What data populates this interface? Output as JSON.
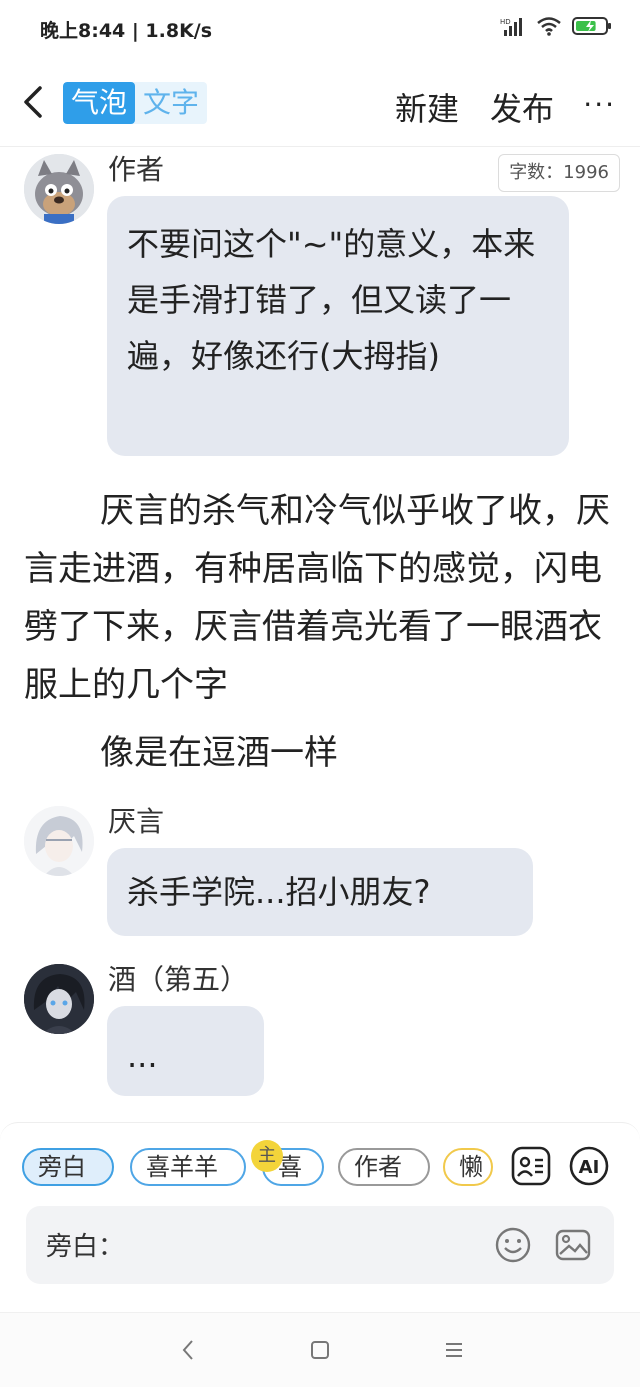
{
  "status_bar": {
    "time": "晚上8:44 | 1.8K/s",
    "battery_level": 0.7
  },
  "header": {
    "mode_active": "气泡",
    "mode_inactive": "文字",
    "new_label": "新建",
    "publish_label": "发布",
    "more_label": "···"
  },
  "word_count": "字数：1996",
  "messages": [
    {
      "speaker": "作者",
      "text": "不要问这个\"~\"的意义，本来是手滑打错了，但又读了一遍，好像还行(大拇指)"
    },
    {
      "speaker": "厌言",
      "text": "杀手学院...招小朋友?"
    },
    {
      "speaker": "酒（第五）",
      "text": "..."
    }
  ],
  "narration": [
    "厌言的杀气和冷气似乎收了收，厌言走进酒，有种居高临下的感觉，闪电劈了下来，厌言借着亮光看了一眼酒衣服上的几个字",
    "像是在逗酒一样"
  ],
  "chips": [
    {
      "label": "旁白"
    },
    {
      "label": "喜羊羊"
    },
    {
      "label": "喜"
    },
    {
      "label": "作者"
    },
    {
      "label": "懒"
    }
  ],
  "host_badge": "主",
  "ai_label": "AI",
  "input": {
    "label": "旁白：",
    "placeholder": ""
  },
  "colors": {
    "accent": "#2f9ee9",
    "bubble": "#e4e8f0",
    "host_badge": "#f3d43a"
  }
}
